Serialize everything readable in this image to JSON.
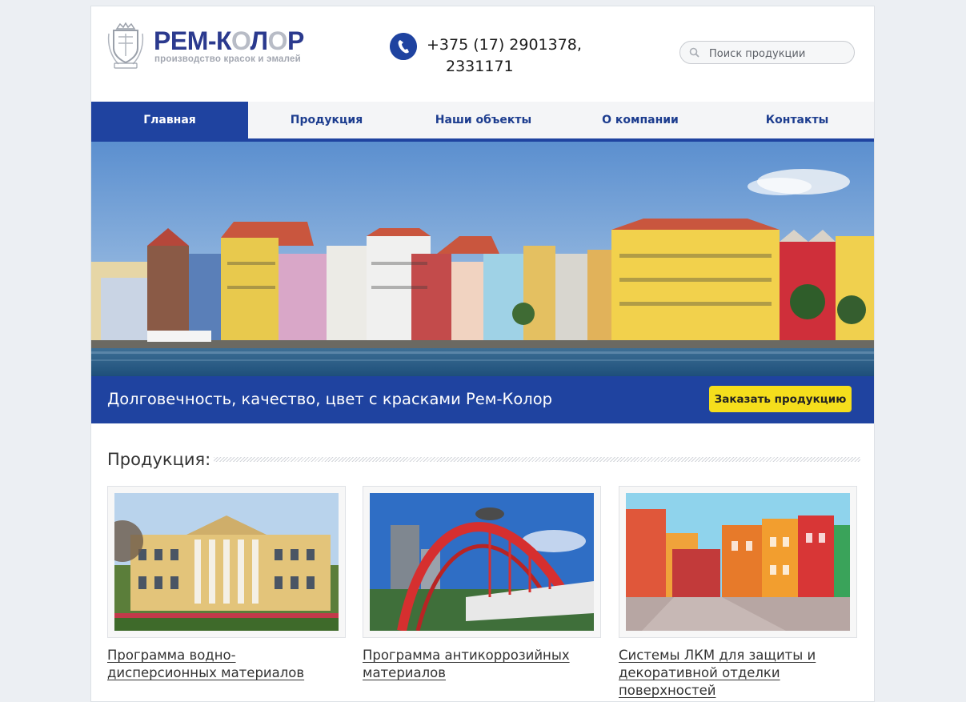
{
  "brand": {
    "name_part1": "РЕМ-К",
    "name_o1": "О",
    "name_part2": "Л",
    "name_o2": "О",
    "name_part3": "Р",
    "tagline": "производство красок и эмалей"
  },
  "contacts": {
    "phone_line1": "+375 (17) 2901378,",
    "phone_line2": "2331171"
  },
  "search": {
    "placeholder": "Поиск продукции"
  },
  "nav": {
    "items": [
      {
        "label": "Главная",
        "active": true
      },
      {
        "label": "Продукция",
        "active": false
      },
      {
        "label": "Наши объекты",
        "active": false
      },
      {
        "label": "О компании",
        "active": false
      },
      {
        "label": "Контакты",
        "active": false
      }
    ]
  },
  "promo": {
    "text": "Долговечность, качество, цвет с красками Рем-Колор",
    "button_label": "Заказать продукцию"
  },
  "section": {
    "title": "Продукция:"
  },
  "products": [
    {
      "title": "Программа водно-дисперсионных материалов"
    },
    {
      "title": "Программа антикоррозийных материалов"
    },
    {
      "title": "Системы ЛКМ для защиты и декоративной отделки поверхностей"
    }
  ],
  "colors": {
    "accent": "#1f43a0",
    "button": "#f5de1c",
    "background": "#eceff3",
    "logo_text": "#2b3a8e",
    "logo_grey": "#b8bcc6"
  },
  "icons": [
    "coat-of-arms-emblem",
    "phone-icon",
    "search-icon"
  ]
}
